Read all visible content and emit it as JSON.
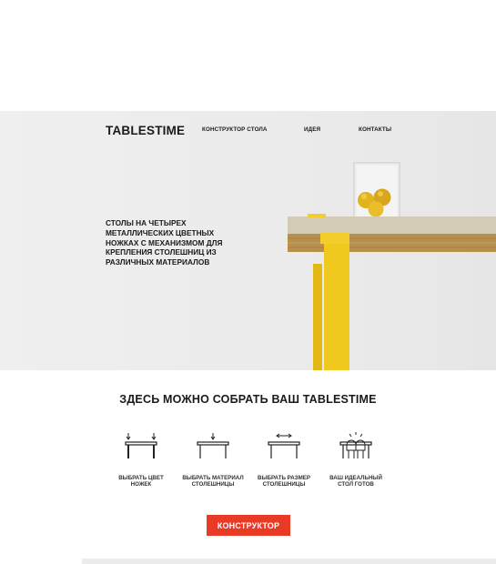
{
  "header": {
    "logo": "TABLESTIME",
    "nav": [
      {
        "label": "КОНСТРУКТОР СТОЛА"
      },
      {
        "label": "ИДЕЯ"
      },
      {
        "label": "КОНТАКТЫ"
      }
    ]
  },
  "hero": {
    "tagline": "СТОЛЫ НА ЧЕТЫРЕХ МЕТАЛЛИЧЕСКИХ ЦВЕТНЫХ НОЖКАХ С МЕХАНИЗМОМ ДЛЯ КРЕПЛЕНИЯ СТОЛЕШНИЦ ИЗ РАЗЛИЧНЫХ МАТЕРИАЛОВ"
  },
  "steps": {
    "title": "ЗДЕСЬ МОЖНО СОБРАТЬ ВАШ TABLESTIME",
    "items": [
      {
        "label": "ВЫБРАТЬ ЦВЕТ НОЖЕК",
        "icon": "table-legs-icon"
      },
      {
        "label": "ВЫБРАТЬ МАТЕРИАЛ СТОЛЕШНИЦЫ",
        "icon": "table-top-icon"
      },
      {
        "label": "ВЫБРАТЬ РАЗМЕР СТОЛЕШНИЦЫ",
        "icon": "table-size-icon"
      },
      {
        "label": "ВАШ ИДЕАЛЬНЫЙ СТОЛ ГОТОВ",
        "icon": "table-ready-icon"
      }
    ]
  },
  "cta": {
    "label": "КОНСТРУКТОР"
  },
  "colors": {
    "accent": "#e93a26",
    "leg": "#f2cd2c",
    "hero_bg": "#ececec"
  }
}
